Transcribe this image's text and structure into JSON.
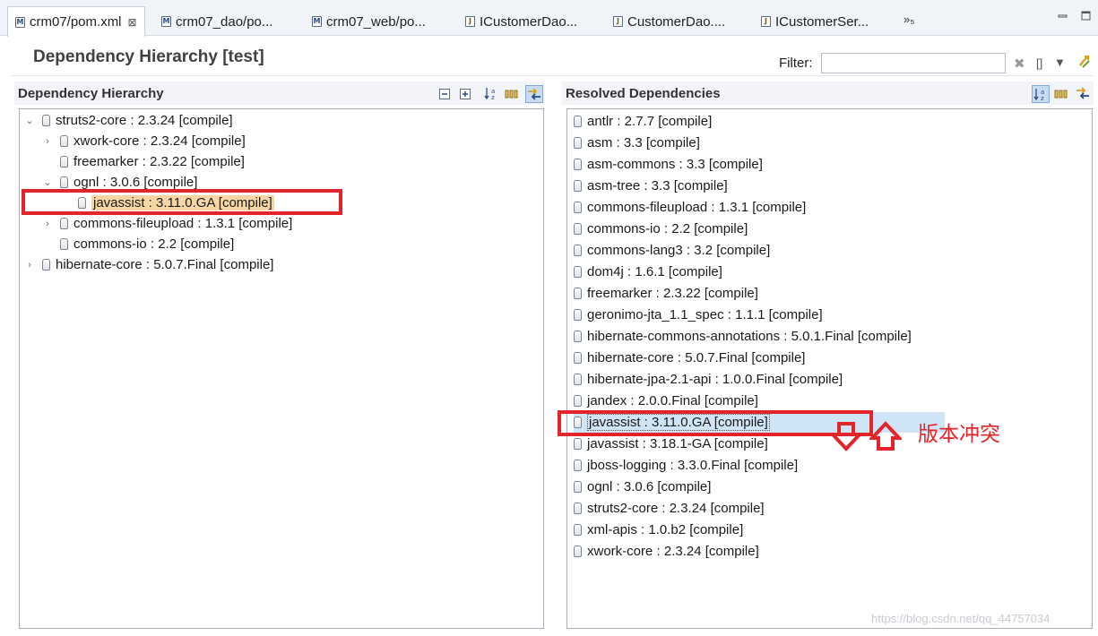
{
  "tabs": [
    {
      "label": "crm07/pom.xml",
      "icon": "M",
      "close": "⊠"
    },
    {
      "label": "crm07_dao/po...",
      "icon": "M"
    },
    {
      "label": "crm07_web/po...",
      "icon": "M"
    },
    {
      "label": "ICustomerDao...",
      "icon": "J"
    },
    {
      "label": "CustomerDao....",
      "icon": "J"
    },
    {
      "label": "ICustomerSer...",
      "icon": "J"
    }
  ],
  "tabs_overflow": "»₅",
  "page_title": "Dependency Hierarchy [test]",
  "filter": {
    "label": "Filter:",
    "value": ""
  },
  "left_panel": {
    "title": "Dependency Hierarchy",
    "rows": [
      {
        "label": "struts2-core : 2.3.24 [compile]",
        "level": 0,
        "toggle": "⌄"
      },
      {
        "label": "xwork-core : 2.3.24 [compile]",
        "level": 1,
        "toggle": "›"
      },
      {
        "label": "freemarker : 2.3.22 [compile]",
        "level": 1,
        "toggle": ""
      },
      {
        "label": "ognl : 3.0.6 [compile]",
        "level": 1,
        "toggle": "⌄"
      },
      {
        "label": "javassist : 3.11.0.GA [compile]",
        "level": 2,
        "toggle": "",
        "highlight": "orange"
      },
      {
        "label": "commons-fileupload : 1.3.1 [compile]",
        "level": 1,
        "toggle": "›"
      },
      {
        "label": "commons-io : 2.2 [compile]",
        "level": 1,
        "toggle": ""
      },
      {
        "label": "hibernate-core : 5.0.7.Final [compile]",
        "level": 0,
        "toggle": "›"
      }
    ]
  },
  "right_panel": {
    "title": "Resolved Dependencies",
    "rows": [
      {
        "label": "antlr : 2.7.7 [compile]"
      },
      {
        "label": "asm : 3.3 [compile]"
      },
      {
        "label": "asm-commons : 3.3 [compile]"
      },
      {
        "label": "asm-tree : 3.3 [compile]"
      },
      {
        "label": "commons-fileupload : 1.3.1 [compile]"
      },
      {
        "label": "commons-io : 2.2 [compile]"
      },
      {
        "label": "commons-lang3 : 3.2 [compile]"
      },
      {
        "label": "dom4j : 1.6.1 [compile]"
      },
      {
        "label": "freemarker : 2.3.22 [compile]"
      },
      {
        "label": "geronimo-jta_1.1_spec : 1.1.1 [compile]"
      },
      {
        "label": "hibernate-commons-annotations : 5.0.1.Final [compile]"
      },
      {
        "label": "hibernate-core : 5.0.7.Final [compile]"
      },
      {
        "label": "hibernate-jpa-2.1-api : 1.0.0.Final [compile]"
      },
      {
        "label": "jandex : 2.0.0.Final [compile]"
      },
      {
        "label": "javassist : 3.11.0.GA [compile]",
        "highlight": "blue"
      },
      {
        "label": "javassist : 3.18.1-GA [compile]"
      },
      {
        "label": "jboss-logging : 3.3.0.Final [compile]"
      },
      {
        "label": "ognl : 3.0.6 [compile]"
      },
      {
        "label": "struts2-core : 2.3.24 [compile]"
      },
      {
        "label": "xml-apis : 1.0.b2 [compile]"
      },
      {
        "label": "xwork-core : 2.3.24 [compile]"
      }
    ]
  },
  "annotation": "版本冲突",
  "watermark": "https://blog.csdn.net/qq_44757034",
  "colors": {
    "annotation_red": "#e3242b",
    "selection_blue": "#cfe4f7",
    "highlight_orange": "#f5d6a4"
  }
}
